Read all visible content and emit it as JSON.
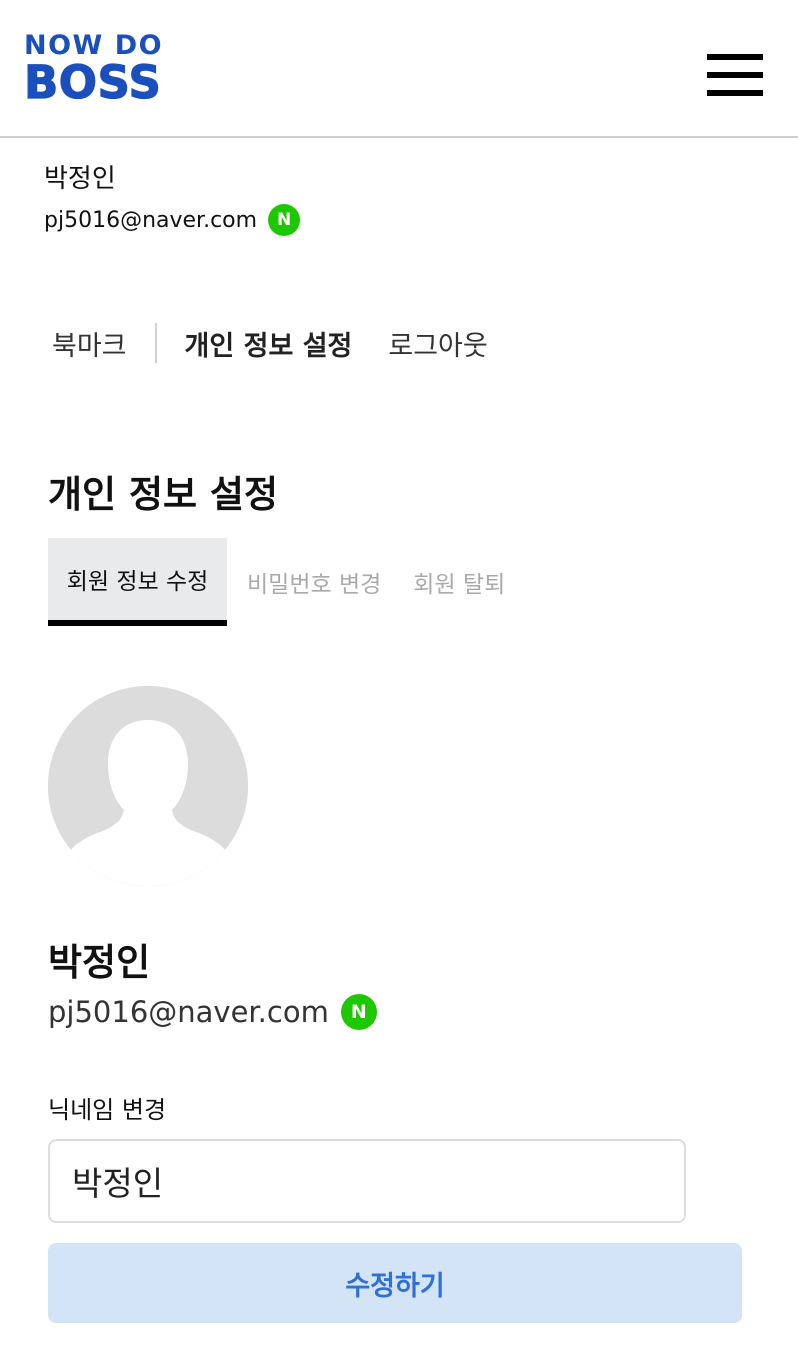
{
  "brand": {
    "logo_line1": "NOW DO",
    "logo_line2": "BOSS",
    "color": "#1a4fbd"
  },
  "header": {
    "menu_icon": "hamburger-menu-icon"
  },
  "account": {
    "name": "박정인",
    "email": "pj5016@naver.com",
    "provider_badge": "N",
    "provider_icon": "naver-icon",
    "provider_color": "#1ec800"
  },
  "top_nav": {
    "bookmark": "북마크",
    "profile_settings": "개인 정보 설정",
    "logout": "로그아웃"
  },
  "page": {
    "title": "개인 정보 설정"
  },
  "tabs": [
    {
      "label": "회원 정보 수정",
      "active": true
    },
    {
      "label": "비밀번호 변경",
      "active": false
    },
    {
      "label": "회원 탈퇴",
      "active": false
    }
  ],
  "profile": {
    "avatar_icon": "default-avatar-icon",
    "name": "박정인",
    "email": "pj5016@naver.com",
    "provider_badge": "N"
  },
  "nickname_form": {
    "label": "닉네임 변경",
    "value": "박정인",
    "submit_label": "수정하기",
    "submit_bg": "#d4e4f7",
    "submit_color": "#2f6fd6"
  }
}
